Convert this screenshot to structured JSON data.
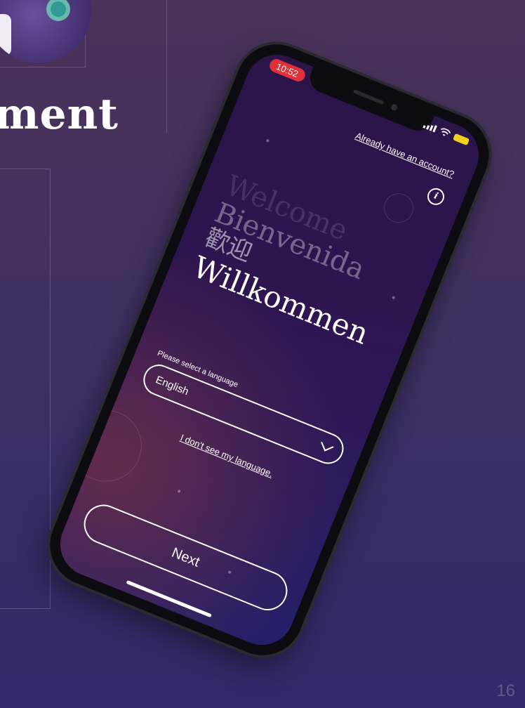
{
  "slide": {
    "title_fragment": "ment",
    "page_number": "16"
  },
  "phone": {
    "status_bar": {
      "time": "10:52"
    },
    "header": {
      "account_link": "Already have an account?",
      "info_icon": "info-icon"
    },
    "welcome_lines": [
      "Welcome",
      "Bienvenida",
      "歡迎",
      "Willkommen"
    ],
    "language": {
      "label": "Please select a language",
      "selected": "English",
      "not_listed_link": "I don't see my language."
    },
    "next_label": "Next"
  },
  "colors": {
    "background_top": "#4a3358",
    "background_bottom": "#33286a",
    "time_pill": "#e0303a",
    "battery": "#f2d020"
  }
}
